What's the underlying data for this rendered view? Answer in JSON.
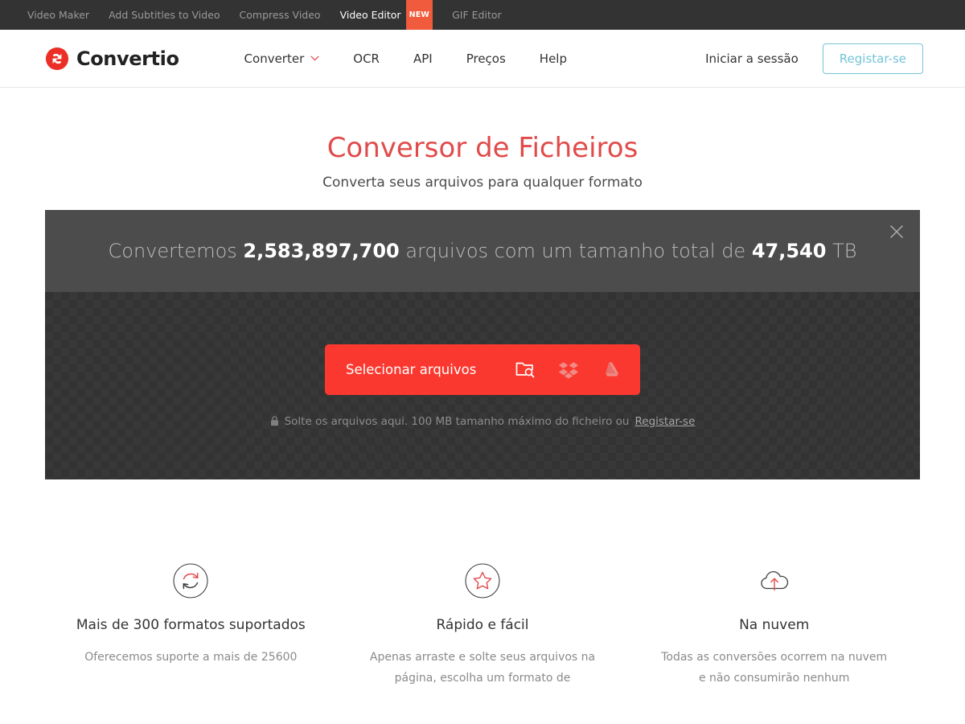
{
  "topbar": {
    "links": [
      {
        "label": "Video Maker",
        "active": false,
        "badge": null
      },
      {
        "label": "Add Subtitles to Video",
        "active": false,
        "badge": null
      },
      {
        "label": "Compress Video",
        "active": false,
        "badge": null
      },
      {
        "label": "Video Editor",
        "active": true,
        "badge": "NEW"
      },
      {
        "label": "GIF Editor",
        "active": false,
        "badge": null
      }
    ]
  },
  "header": {
    "brand": "Convertio",
    "brand_icon": "convertio-logo-icon",
    "nav": [
      {
        "label": "Converter",
        "has_chevron": true
      },
      {
        "label": "OCR",
        "has_chevron": false
      },
      {
        "label": "API",
        "has_chevron": false
      },
      {
        "label": "Preços",
        "has_chevron": false
      },
      {
        "label": "Help",
        "has_chevron": false
      }
    ],
    "login_label": "Iniciar a sessão",
    "signup_label": "Registar-se"
  },
  "hero": {
    "title": "Conversor de Ficheiros",
    "subtitle": "Converta seus arquivos para qualquer formato"
  },
  "uploader": {
    "stats": {
      "prefix": "Convertemos ",
      "files_count": "2,583,897,700",
      "middle": " arquivos com um tamanho total de ",
      "total_size": "47,540",
      "suffix": " TB",
      "close_icon": "close-icon"
    },
    "select_label": "Selecionar arquivos",
    "sources": [
      {
        "name": "folder-search-icon"
      },
      {
        "name": "dropbox-icon"
      },
      {
        "name": "google-drive-icon"
      }
    ],
    "hint": {
      "lock_icon": "lock-icon",
      "text": "Solte os arquivos aqui. 100 MB tamanho máximo do ficheiro ou ",
      "link": "Registar-se"
    }
  },
  "features": [
    {
      "icon": "convert-arrows-circle-icon",
      "title": "Mais de 300 formatos suportados",
      "desc": "Oferecemos suporte a mais de 25600"
    },
    {
      "icon": "star-circle-icon",
      "title": "Rápido e fácil",
      "desc": "Apenas arraste e solte seus arquivos na página, escolha um formato de"
    },
    {
      "icon": "cloud-upload-icon",
      "title": "Na nuvem",
      "desc": "Todas as conversões ocorrem na nuvem e não consumirão nenhum"
    }
  ],
  "colors": {
    "accent_red": "#fb382f",
    "title_red": "#e14b4b",
    "topbar_bg": "#333333",
    "signup_border": "#74c4d8",
    "badge_orange": "#ef5b3c",
    "stats_bg": "#4c4c4c"
  }
}
